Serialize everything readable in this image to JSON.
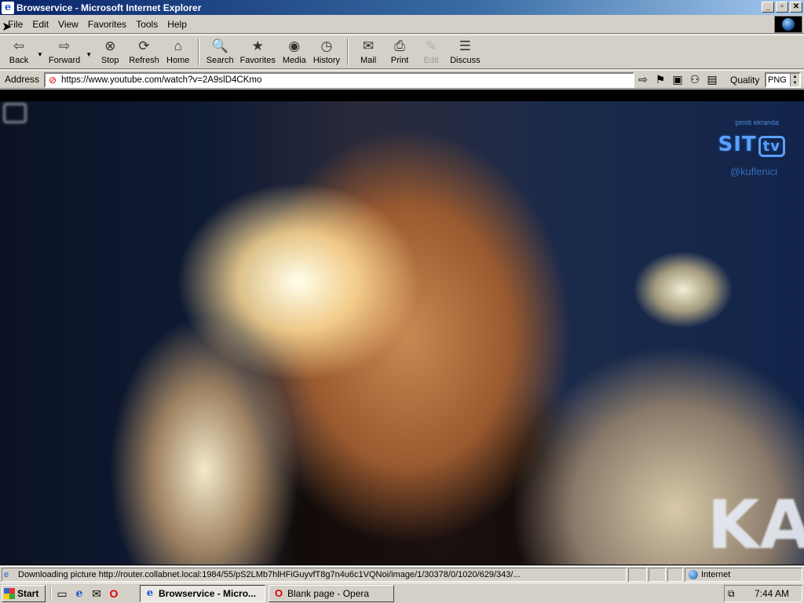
{
  "window": {
    "title": "Browservice - Microsoft Internet Explorer",
    "controls": {
      "minimize": "_",
      "maximize": "▫",
      "close": "✕"
    }
  },
  "menu": {
    "items": [
      "File",
      "Edit",
      "View",
      "Favorites",
      "Tools",
      "Help"
    ]
  },
  "toolbar": {
    "buttons": [
      {
        "label": "Back",
        "icon": "back-arrow-icon",
        "glyph": "⇦",
        "disabled": false
      },
      {
        "label": "Forward",
        "icon": "forward-arrow-icon",
        "glyph": "⇨",
        "disabled": false
      },
      {
        "label": "Stop",
        "icon": "stop-icon",
        "glyph": "⊗",
        "disabled": false
      },
      {
        "label": "Refresh",
        "icon": "refresh-icon",
        "glyph": "⟳",
        "disabled": false
      },
      {
        "label": "Home",
        "icon": "home-icon",
        "glyph": "⌂",
        "disabled": false
      },
      {
        "label": "Search",
        "icon": "search-icon",
        "glyph": "🔍",
        "disabled": false
      },
      {
        "label": "Favorites",
        "icon": "favorites-icon",
        "glyph": "★",
        "disabled": false
      },
      {
        "label": "Media",
        "icon": "media-icon",
        "glyph": "◉",
        "disabled": false
      },
      {
        "label": "History",
        "icon": "history-icon",
        "glyph": "◷",
        "disabled": false
      },
      {
        "label": "Mail",
        "icon": "mail-icon",
        "glyph": "✉",
        "disabled": false
      },
      {
        "label": "Print",
        "icon": "print-icon",
        "glyph": "⎙",
        "disabled": false
      },
      {
        "label": "Edit",
        "icon": "edit-icon",
        "glyph": "✎",
        "disabled": true
      },
      {
        "label": "Discuss",
        "icon": "discuss-icon",
        "glyph": "☰",
        "disabled": false
      }
    ]
  },
  "address": {
    "label": "Address",
    "url": "https://www.youtube.com/watch?v=2A9slD4CKmo",
    "quality_label": "Quality",
    "quality_value": "PNG"
  },
  "video": {
    "overlay_pre": "şimdi ekranda",
    "overlay_brand": "SIT",
    "overlay_brand_tv": "tv",
    "overlay_handle": "@kuflenici",
    "overlay_corner": "KA"
  },
  "status": {
    "text": "Downloading picture http://router.collabnet.local:1984/55/pS2LMb7hlHFiGuyvfT8g7n4u6c1VQNoi/image/1/30378/0/1020/629/343/...",
    "zone": "Internet"
  },
  "taskbar": {
    "start_label": "Start",
    "tasks": [
      {
        "label": "Browservice - Micro...",
        "icon": "ie-icon",
        "active": true
      },
      {
        "label": "Blank page - Opera",
        "icon": "opera-icon",
        "active": false
      }
    ],
    "clock": "7:44 AM"
  }
}
